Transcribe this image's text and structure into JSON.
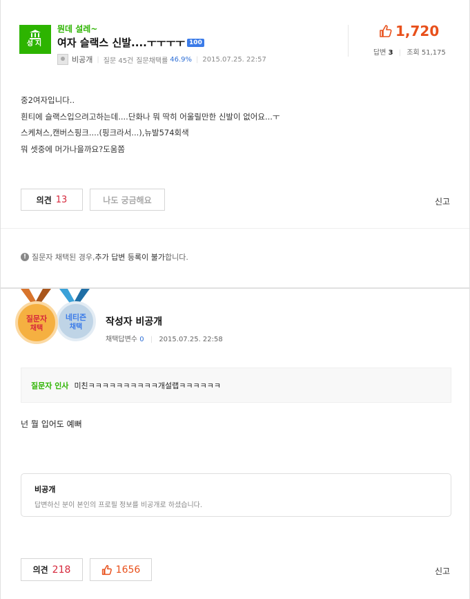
{
  "question": {
    "badge_label": "성지",
    "category": "뭔데 설레~",
    "title": "여자 슬랙스 신발....ㅜㅜㅜㅜ",
    "points_badge": "100",
    "author": "비공개",
    "question_count_text": "질문 45건",
    "adoption_label": "질문채택률",
    "adoption_rate": "46.9%",
    "datetime": "2015.07.25. 22:57",
    "likes": "1,720",
    "answers_label": "답변",
    "answers_count": "3",
    "views_label": "조회",
    "views_count": "51,175",
    "body_lines": [
      "중2여자입니다..",
      "흰티에 슬랙스입으려고하는데....단화나 뭐 딱히 어울릴만한 신발이 없어요...ㅜ",
      "스케쳐스,캔버스핑크....(핑크라서...),뉴발574회색",
      "뭐 셋중에 머가나을까요?도움쫌"
    ],
    "opinion_label": "의견",
    "opinion_count": "13",
    "curious_label": "나도 궁금해요",
    "report_label": "신고"
  },
  "notice": {
    "pre": "질문자 채택된 경우, ",
    "bold": "추가 답변 등록이 불가",
    "post": "합니다."
  },
  "answer": {
    "medal1_line1": "질문자",
    "medal1_line2": "채택",
    "medal2_line1": "네티즌",
    "medal2_line2": "채택",
    "author": "작성자 비공개",
    "adopted_label": "채택답변수",
    "adopted_count": "0",
    "datetime": "2015.07.25. 22:58",
    "thanks_label": "질문자 인사",
    "thanks_text": "미친ㅋㅋㅋㅋㅋㅋㅋㅋㅋㅋ개설랩ㅋㅋㅋㅋㅋㅋ",
    "body": "넌 뭘 입어도 예뻐",
    "private_title": "비공개",
    "private_desc": "답변하신 분이 본인의 프로필 정보를 비공개로 하셨습니다.",
    "opinion_label": "의견",
    "opinion_count": "218",
    "likes": "1656",
    "report_label": "신고"
  },
  "colors": {
    "brand_green": "#2db400",
    "like_orange": "#e8501b",
    "count_red": "#d6283c",
    "link_blue": "#2e6fd6"
  }
}
